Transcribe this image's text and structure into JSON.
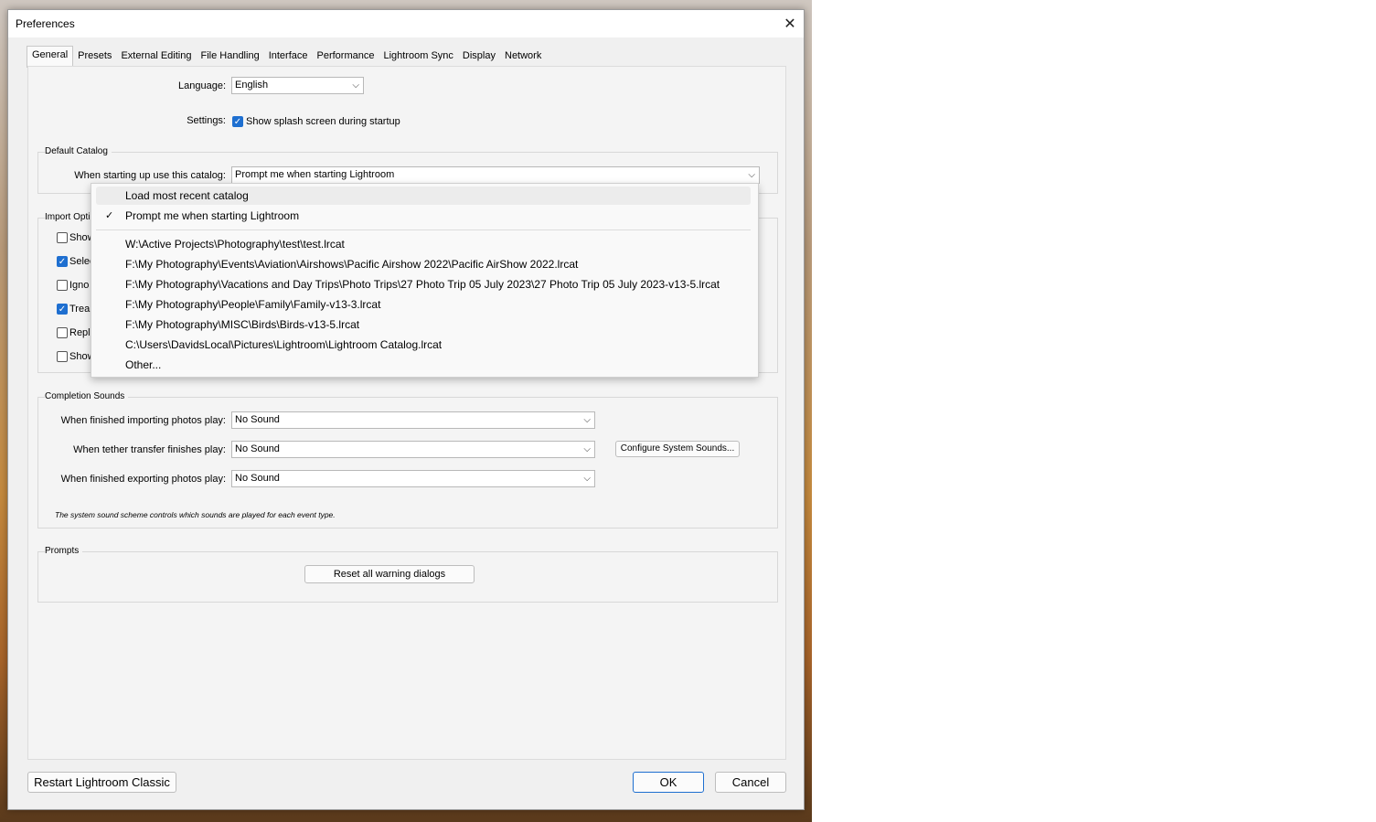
{
  "window": {
    "title": "Preferences"
  },
  "tabs": [
    "General",
    "Presets",
    "External Editing",
    "File Handling",
    "Interface",
    "Performance",
    "Lightroom Sync",
    "Display",
    "Network"
  ],
  "general": {
    "language_label": "Language:",
    "language_value": "English",
    "settings_label": "Settings:",
    "splash_label": "Show splash screen during startup"
  },
  "default_catalog": {
    "title": "Default Catalog",
    "label": "When starting up use this catalog:",
    "value": "Prompt me when starting Lightroom"
  },
  "catalog_dropdown": {
    "items": [
      "Load most recent catalog",
      "Prompt me when starting Lightroom"
    ],
    "recent": [
      "W:\\Active Projects\\Photography\\test\\test.lrcat",
      "F:\\My Photography\\Events\\Aviation\\Airshows\\Pacific Airshow 2022\\Pacific AirShow 2022.lrcat",
      "F:\\My Photography\\Vacations and Day Trips\\Photo Trips\\27 Photo Trip 05 July 2023\\27 Photo Trip 05 July 2023-v13-5.lrcat",
      "F:\\My Photography\\People\\Family\\Family-v13-3.lrcat",
      "F:\\My Photography\\MISC\\Birds\\Birds-v13-5.lrcat",
      "C:\\Users\\DavidsLocal\\Pictures\\Lightroom\\Lightroom Catalog.lrcat",
      "Other..."
    ]
  },
  "import_options": {
    "title": "Import Opti",
    "items": [
      "Show",
      "Selec",
      "Igno",
      "Trea",
      "Repl",
      "Show"
    ]
  },
  "completion_sounds": {
    "title": "Completion Sounds",
    "import_label": "When finished importing photos play:",
    "import_value": "No Sound",
    "tether_label": "When tether transfer finishes play:",
    "tether_value": "No Sound",
    "export_label": "When finished exporting photos play:",
    "export_value": "No Sound",
    "configure_button": "Configure System Sounds...",
    "note": "The system sound scheme controls which sounds are played for each event type."
  },
  "prompts": {
    "title": "Prompts",
    "reset_button": "Reset all warning dialogs"
  },
  "footer": {
    "restart_button": "Restart Lightroom Classic",
    "ok_button": "OK",
    "cancel_button": "Cancel"
  }
}
